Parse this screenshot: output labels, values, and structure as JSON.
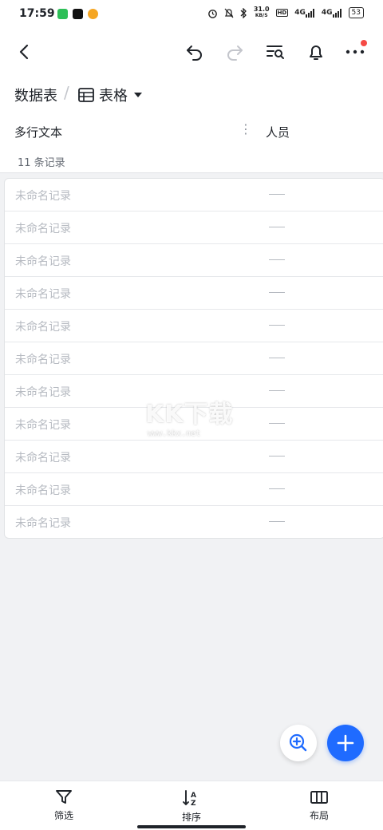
{
  "status_bar": {
    "time": "17:59",
    "network_speed_top": "31.0",
    "network_speed_unit": "KB/S",
    "hd_badge": "HD",
    "signal_1": "4G",
    "signal_2": "4G",
    "battery": "53"
  },
  "breadcrumb": {
    "root": "数据表",
    "view_name": "表格"
  },
  "columns": {
    "primary": "多行文本",
    "second": "人员"
  },
  "summary": {
    "record_count_text": "11 条记录"
  },
  "records": [
    {
      "name": "未命名记录"
    },
    {
      "name": "未命名记录"
    },
    {
      "name": "未命名记录"
    },
    {
      "name": "未命名记录"
    },
    {
      "name": "未命名记录"
    },
    {
      "name": "未命名记录"
    },
    {
      "name": "未命名记录"
    },
    {
      "name": "未命名记录"
    },
    {
      "name": "未命名记录"
    },
    {
      "name": "未命名记录"
    },
    {
      "name": "未命名记录"
    }
  ],
  "watermark": {
    "main": "KK下载",
    "sub": "www.kkx.net"
  },
  "bottom_bar": {
    "filter_label": "筛选",
    "sort_label": "排序",
    "layout_label": "布局"
  },
  "colors": {
    "accent": "#1f6bff",
    "notification_dot": "#f54a45",
    "placeholder_text": "#b6bac1"
  }
}
